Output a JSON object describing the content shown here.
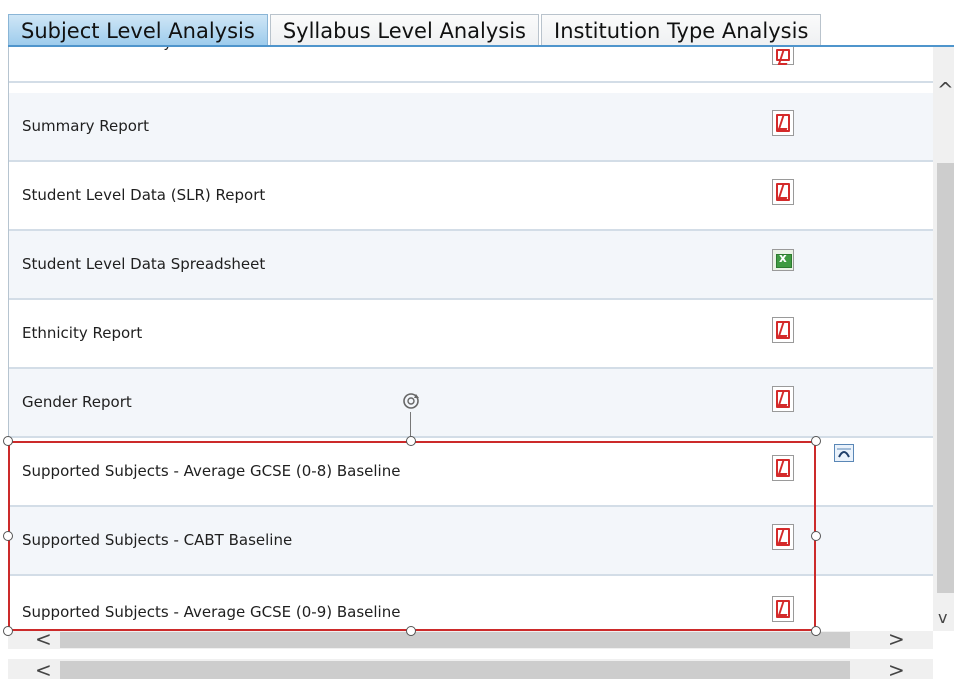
{
  "tabs": [
    {
      "label": "Subject Level Analysis",
      "active": true
    },
    {
      "label": "Syllabus Level Analysis",
      "active": false
    },
    {
      "label": "Institution Type Analysis",
      "active": false
    }
  ],
  "rows": [
    {
      "label": "Executive Summary",
      "icon": "pdf-icon"
    },
    {
      "label": "Summary Report",
      "icon": "pdf-icon"
    },
    {
      "label": "Student Level Data (SLR) Report",
      "icon": "pdf-icon"
    },
    {
      "label": "Student Level Data Spreadsheet",
      "icon": "excel-icon"
    },
    {
      "label": "Ethnicity Report",
      "icon": "pdf-icon"
    },
    {
      "label": "Gender Report",
      "icon": "pdf-icon"
    },
    {
      "label": "Supported Subjects - Average GCSE (0-8) Baseline",
      "icon": "pdf-icon"
    },
    {
      "label": "Supported Subjects - CABT Baseline",
      "icon": "pdf-icon"
    },
    {
      "label": "Supported Subjects - Average GCSE (0-9) Baseline",
      "icon": "pdf-icon"
    }
  ],
  "colors": {
    "active_tab": "#9ccbec",
    "selection_border": "#cc2a2a",
    "pdf_red": "#d42a2a",
    "excel_green": "#3f9b41"
  },
  "scroll": {
    "up_arrow": "^",
    "down_arrow": "v",
    "left_arrow": "<",
    "right_arrow": ">"
  }
}
